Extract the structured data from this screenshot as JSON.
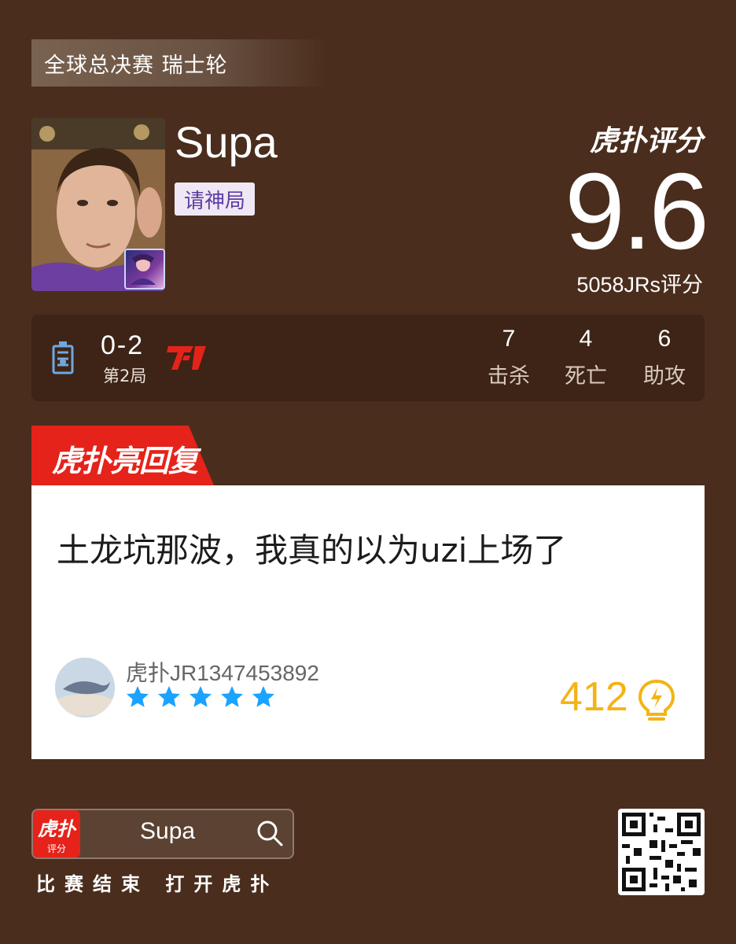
{
  "header": {
    "tournament": "全球总决赛 瑞士轮"
  },
  "player": {
    "name": "Supa",
    "tag": "请神局"
  },
  "rating": {
    "brand": "虎扑评分",
    "score": "9.6",
    "count_text": "5058JRs评分"
  },
  "match": {
    "score": "0-2",
    "game": "第2局",
    "stats": [
      {
        "value": "7",
        "label": "击杀"
      },
      {
        "value": "4",
        "label": "死亡"
      },
      {
        "value": "6",
        "label": "助攻"
      }
    ]
  },
  "highlight": {
    "section_title": "虎扑亮回复",
    "comment": "土龙坑那波，我真的以为uzi上场了",
    "username": "虎扑JR1347453892",
    "star_count": 5,
    "likes": "412"
  },
  "footer": {
    "logo_text": "虎扑",
    "logo_sub": "评分",
    "search_text": "Supa",
    "slogan": "比赛结束 打开虎扑"
  },
  "colors": {
    "background": "#4a2d1d",
    "red": "#e5231b",
    "star": "#1aa3ff",
    "like": "#f3b415"
  }
}
